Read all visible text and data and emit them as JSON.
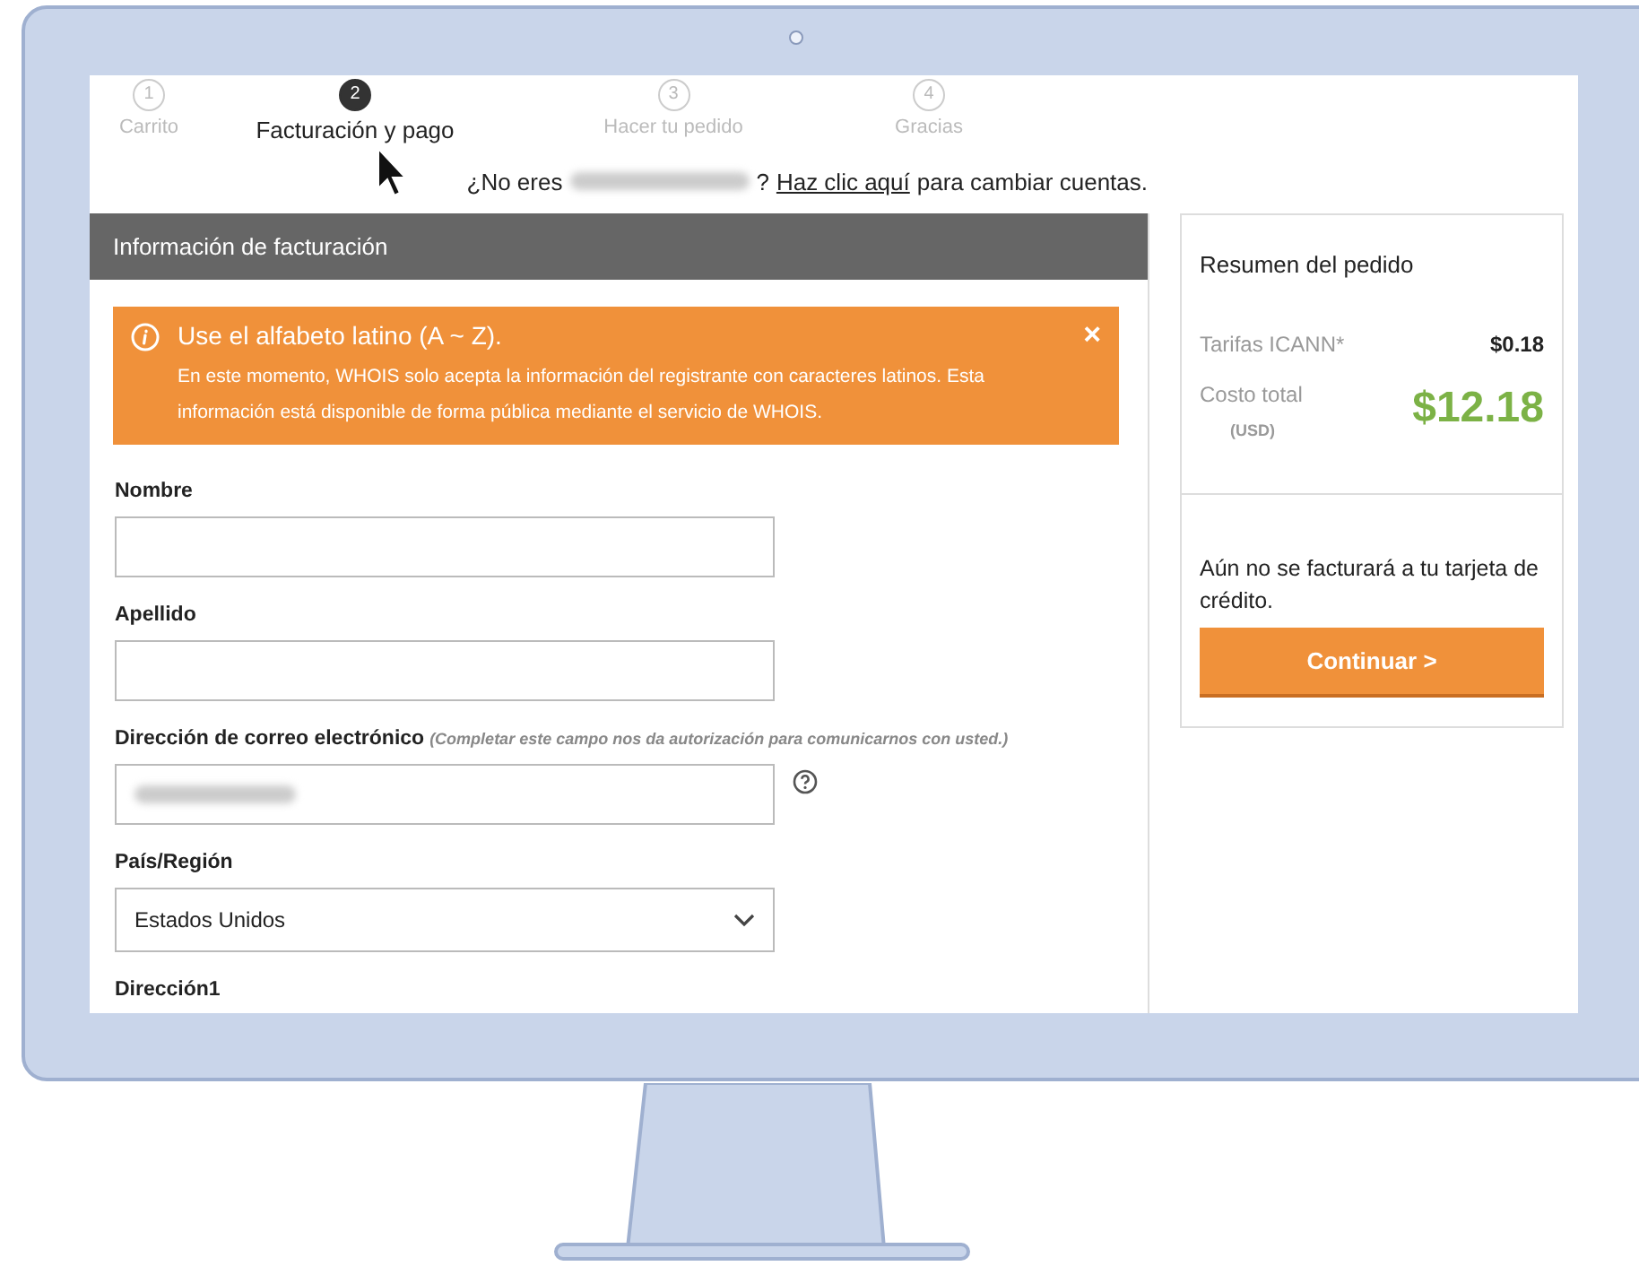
{
  "steps": [
    {
      "number": "1",
      "label": "Carrito",
      "selected": false
    },
    {
      "number": "2",
      "label": "Facturación y pago",
      "selected": true
    },
    {
      "number": "3",
      "label": "Hacer tu pedido",
      "selected": false
    },
    {
      "number": "4",
      "label": "Gracias",
      "selected": false
    }
  ],
  "account_notice": {
    "prefix": "¿No eres",
    "suffix": "?",
    "link": "Haz clic aquí",
    "rest": "para cambiar cuentas."
  },
  "billing": {
    "title": "Información de facturación",
    "alert": {
      "title": "Use el alfabeto latino (A ~ Z).",
      "body": "En este momento, WHOIS solo acepta la información del registrante con caracteres latinos. Esta información está disponible de forma pública mediante el servicio de WHOIS.",
      "close": "×"
    },
    "fields": [
      {
        "kind": "text",
        "label": "Nombre"
      },
      {
        "kind": "text",
        "label": "Apellido"
      },
      {
        "kind": "email",
        "label": "Dirección de correo electrónico",
        "note": "(Completar este campo nos da autorización para comunicarnos con usted.)"
      },
      {
        "kind": "select",
        "label": "País/Región",
        "value": "Estados Unidos"
      },
      {
        "kind": "partial",
        "label": "Dirección1"
      }
    ]
  },
  "summary": {
    "title": "Resumen del pedido",
    "fee_label": "Tarifas ICANN*",
    "fee_value": "$0.18",
    "total_label": "Costo total",
    "currency": "(USD)",
    "total_value": "$12.18",
    "notice": "Aún no se facturará a tu tarjeta de crédito.",
    "button": "Continuar >"
  }
}
